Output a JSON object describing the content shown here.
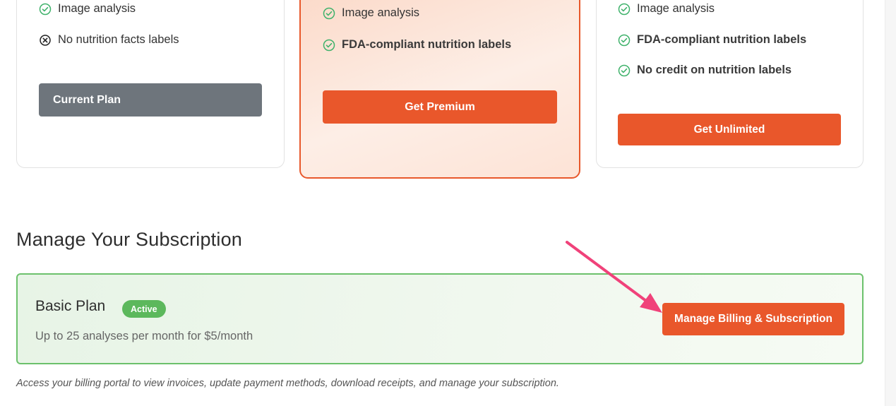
{
  "plans": {
    "basic": {
      "features": [
        {
          "label": "Image analysis",
          "icon": "check-circle-icon",
          "bold": false
        },
        {
          "label": "No nutrition facts labels",
          "icon": "x-circle-icon",
          "bold": false
        }
      ],
      "button_label": "Current Plan"
    },
    "premium": {
      "features": [
        {
          "label": "Image analysis",
          "icon": "check-circle-icon",
          "bold": false
        },
        {
          "label": "FDA-compliant nutrition labels",
          "icon": "check-circle-icon",
          "bold": true
        }
      ],
      "button_label": "Get Premium"
    },
    "unlimited": {
      "features": [
        {
          "label": "Image analysis",
          "icon": "check-circle-icon",
          "bold": false
        },
        {
          "label": "FDA-compliant nutrition labels",
          "icon": "check-circle-icon",
          "bold": true
        },
        {
          "label": "No credit on nutrition labels",
          "icon": "check-circle-icon",
          "bold": true
        }
      ],
      "button_label": "Get Unlimited"
    }
  },
  "subscription": {
    "title": "Manage Your Subscription",
    "plan_name": "Basic Plan",
    "status_badge": "Active",
    "description": "Up to 25 analyses per month for $5/month",
    "manage_button_label": "Manage Billing & Subscription",
    "helper_text": "Access your billing portal to view invoices, update payment methods, download receipts, and manage your subscription."
  },
  "colors": {
    "accent": "#e9572b",
    "success": "#5cb85c",
    "check": "#3fb26b",
    "annotation_arrow": "#f0427a",
    "current_plan_button": "#6e757c"
  }
}
